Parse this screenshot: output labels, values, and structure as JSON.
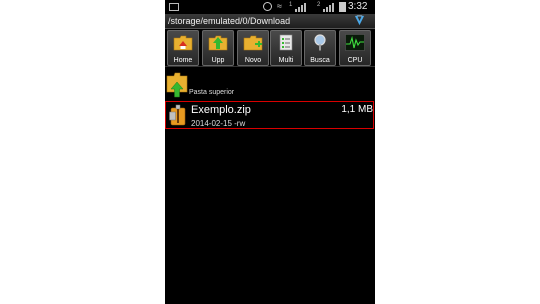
{
  "status_bar": {
    "sim1": "1",
    "sim2": "2",
    "time": "3:32"
  },
  "path_bar": {
    "path": "/storage/emulated/0/Download",
    "menu_icon": "v-logo-icon"
  },
  "toolbar": {
    "buttons": [
      {
        "label": "Home",
        "icon": "home-folder-icon"
      },
      {
        "label": "Upp",
        "icon": "up-folder-icon"
      },
      {
        "label": "Novo",
        "icon": "new-folder-icon"
      },
      {
        "label": "Multi",
        "icon": "multi-select-icon"
      },
      {
        "label": "Busca",
        "icon": "search-icon"
      },
      {
        "label": "CPU",
        "icon": "cpu-icon"
      }
    ]
  },
  "files": {
    "parent_label": "Pasta superior",
    "items": [
      {
        "name": "Exemplo.zip",
        "meta": "2014-02-15 -rw",
        "size": "1,1 MB",
        "icon": "zip-archive-icon"
      }
    ]
  },
  "colors": {
    "background": "#000000",
    "selection_border": "#d80000",
    "folder_yellow": "#e8b030",
    "arrow_green": "#36b830"
  }
}
